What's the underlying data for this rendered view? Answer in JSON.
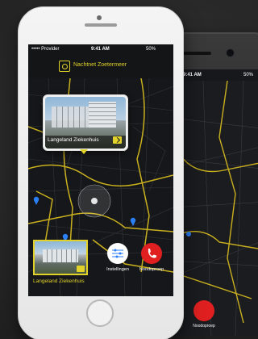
{
  "status_bar": {
    "carrier": "••••• Provider",
    "time": "9:41 AM",
    "battery": "50%"
  },
  "app": {
    "title": "Nachtnet Zoetermeer",
    "logo_icon": "eye-icon",
    "accent_color": "#e0d22b"
  },
  "map": {
    "pin_color": "#2a7ff5",
    "selected_pin_color": "#e0d22b",
    "road_color": "#c9b01f"
  },
  "popup": {
    "caption": "Langeland Ziekenhuis",
    "action_icon": "route-icon"
  },
  "bottom": {
    "thumb_caption": "Langeland Ziekenhuis",
    "settings_label": "Instellingen",
    "settings_icon": "sliders-icon",
    "emergency_label": "Noodoproep",
    "emergency_icon": "phone-icon",
    "emergency_color": "#e02020"
  }
}
